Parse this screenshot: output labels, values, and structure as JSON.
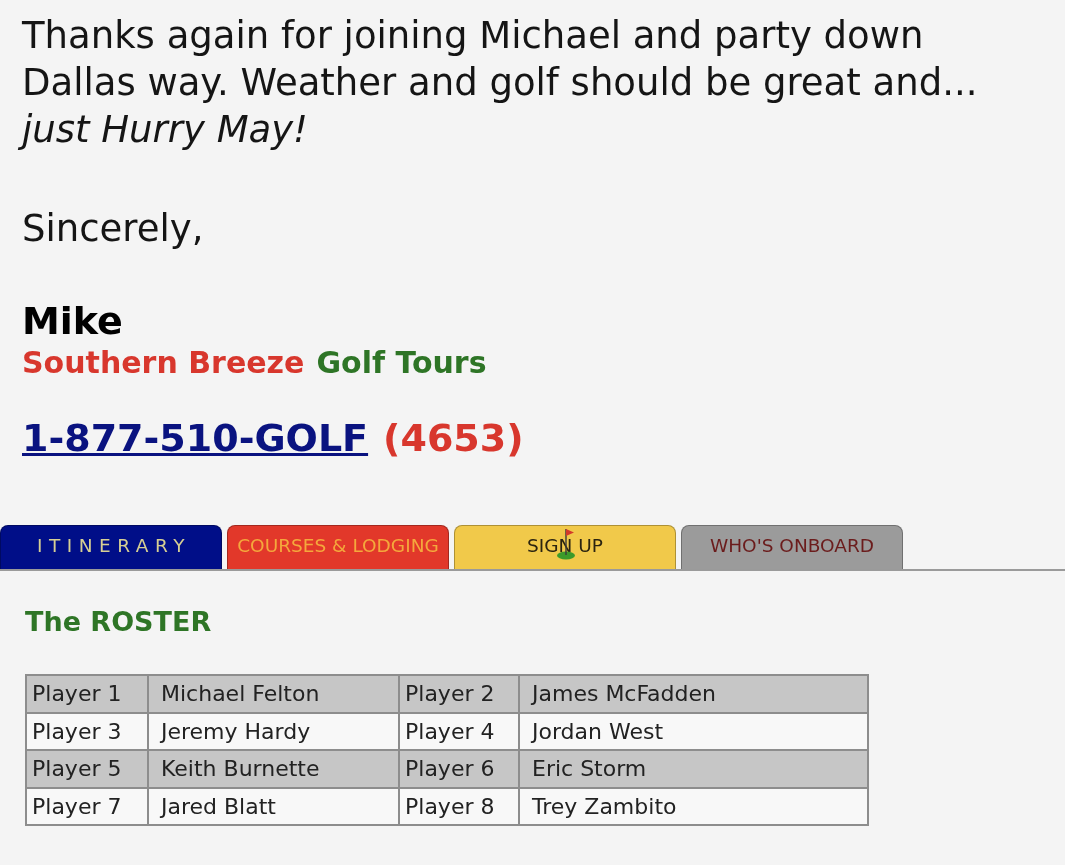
{
  "letter": {
    "message": "Thanks again for joining Michael and party down Dallas way. Weather and golf should be great and...",
    "tagline": "just Hurry May!",
    "closing": "Sincerely,",
    "signer": "Mike",
    "company": [
      {
        "text": "Southern Breeze",
        "color": "#d8372d"
      },
      {
        "text": "Golf Tours",
        "color": "#2e7526"
      }
    ],
    "phone": {
      "link": "1-877-510-GOLF",
      "digits": "(4653)"
    }
  },
  "tabs": [
    {
      "label": "ITINERARY",
      "color": "#000e88",
      "flag": false
    },
    {
      "label": "COURSES & LODGING",
      "color": "#e2382a",
      "flag": false
    },
    {
      "label": "SIGN UP",
      "color": "#f1c94a",
      "flag": true
    },
    {
      "label": "WHO'S ONBOARD",
      "color": "#9b9b9b",
      "flag": false
    }
  ],
  "roster": {
    "title": "The ROSTER",
    "rows": [
      [
        "Player 1",
        "Michael Felton",
        "Player 2",
        "James McFadden"
      ],
      [
        "Player 3",
        "Jeremy Hardy",
        "Player 4",
        "Jordan West"
      ],
      [
        "Player 5",
        "Keith Burnette",
        "Player 6",
        "Eric Storm"
      ],
      [
        "Player 7",
        "Jared Blatt",
        "Player 8",
        "Trey Zambito"
      ]
    ]
  }
}
